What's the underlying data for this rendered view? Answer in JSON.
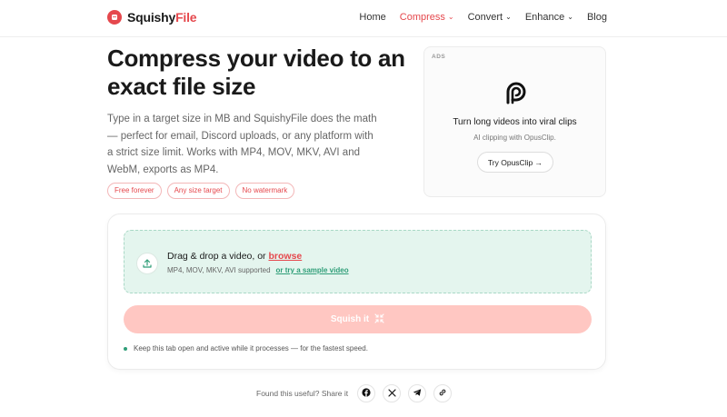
{
  "header": {
    "brand_a": "Squishy",
    "brand_b": "File",
    "nav": [
      {
        "label": "Home",
        "active": false,
        "dropdown": false
      },
      {
        "label": "Compress",
        "active": true,
        "dropdown": true
      },
      {
        "label": "Convert",
        "active": false,
        "dropdown": true
      },
      {
        "label": "Enhance",
        "active": false,
        "dropdown": true
      },
      {
        "label": "Blog",
        "active": false,
        "dropdown": false
      }
    ]
  },
  "hero": {
    "title": "Compress your video to an exact file size",
    "description": "Type in a target size in MB and SquishyFile does the math — perfect for email, Discord uploads, or any platform with a strict size limit. Works with MP4, MOV, MKV, AVI and WebM, exports as MP4.",
    "pills": [
      "Free forever",
      "Any size target",
      "No watermark"
    ]
  },
  "ad": {
    "label": "ADS",
    "logo_icon": "opusclip-logo-icon",
    "title": "Turn long videos into viral clips",
    "subtitle": "AI clipping with OpusClip.",
    "button_label": "Try OpusClip →"
  },
  "upload": {
    "icon": "upload-icon",
    "title_prefix": "Drag & drop a video, or ",
    "browse_label": "browse",
    "supported_text": "MP4, MOV, MKV, AVI supported",
    "sample_link": "or try a sample video",
    "squish_label": "Squish it",
    "squish_icon": "shrink-arrows-icon",
    "note": "Keep this tab open and active while it processes — for the fastest speed."
  },
  "share": {
    "label": "Found this useful? Share it",
    "buttons": [
      "facebook-icon",
      "x-icon",
      "telegram-icon",
      "link-icon"
    ]
  },
  "colors": {
    "accent": "#e5484d",
    "dropzone_bg": "#e4f5ee",
    "link_green": "#2f9e78",
    "squish_button": "#ffc7c2"
  }
}
